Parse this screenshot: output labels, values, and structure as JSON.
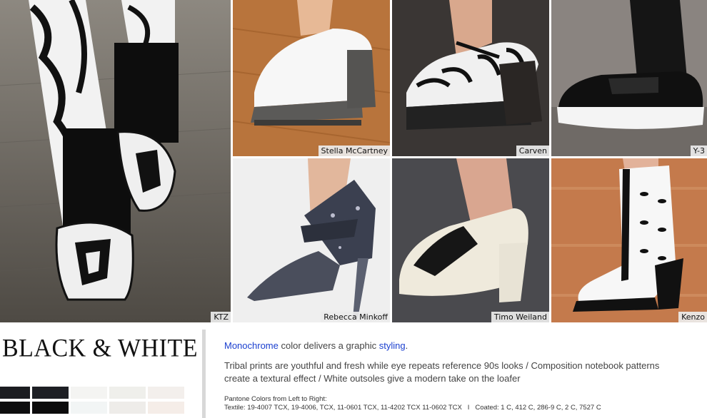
{
  "photos": [
    {
      "id": "ktz",
      "caption": "KTZ",
      "bg": "#6d6962"
    },
    {
      "id": "stella",
      "caption": "Stella McCartney",
      "bg": "#b8743c"
    },
    {
      "id": "carven",
      "caption": "Carven",
      "bg": "#3a3634"
    },
    {
      "id": "y3",
      "caption": "Y-3",
      "bg": "#8a8480"
    },
    {
      "id": "rebecca",
      "caption": "Rebecca Minkoff",
      "bg": "#eeeeee"
    },
    {
      "id": "timo",
      "caption": "Timo Weiland",
      "bg": "#4a4a4e"
    },
    {
      "id": "kenzo",
      "caption": "Kenzo",
      "bg": "#c47a4c"
    }
  ],
  "title": "BLACK & WHITE",
  "swatches": {
    "row1": [
      "#1b1c20",
      "#1d1f24",
      "#f4f4f2",
      "#efefeb",
      "#f3efec"
    ],
    "row2": [
      "#0e0e0f",
      "#0c0b0c",
      "#f2f5f5",
      "#eeece9",
      "#f5ede8"
    ]
  },
  "description": {
    "link1": "Monochrome",
    "mid": " color delivers a graphic ",
    "link2": "styling",
    "end": ".",
    "body": "Tribal prints are youthful and fresh while eye repeats reference 90s looks / Composition notebook patterns create a textural effect / White outsoles give a modern take on the loafer",
    "pantone_heading": "Pantone Colors from Left to Right:",
    "pantone_line": "Textile: 19-4007 TCX, 19-4006, TCX, 11-0601 TCX, 11-4202 TCX 11-0602 TCX   I   Coated: 1 C, 412 C, 286-9 C, 2 C, 7527 C"
  }
}
